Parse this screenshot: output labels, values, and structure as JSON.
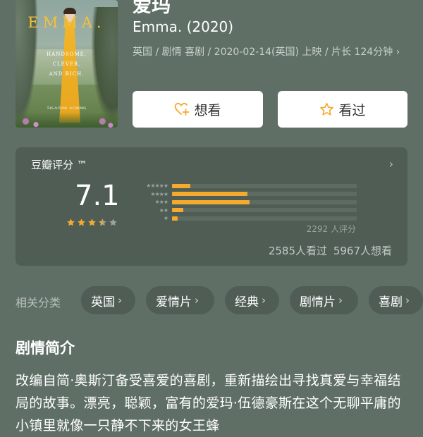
{
  "poster": {
    "title": "EMMA.",
    "tagline_lines": [
      "HANDSOME,",
      "CLEVER,",
      "AND RICH."
    ],
    "small_text": "THIS AUTUMN · IN CINEMAS"
  },
  "movie": {
    "title": "爱玛",
    "original_title": "Emma. (2020)",
    "meta": "英国 / 剧情 喜剧 / 2020-02-14(英国) 上映 / 片长 124分钟",
    "meta_chevron": "›"
  },
  "actions": {
    "want_label": "想看",
    "want_icon": "heart-plus-icon",
    "seen_label": "看过",
    "seen_icon": "star-outline-icon"
  },
  "rating": {
    "label": "豆瓣评分 ™",
    "score": "7.1",
    "stars_value": 3.5,
    "stars_max": 5,
    "distribution": [
      {
        "stars": "★★★★★",
        "percent": 10
      },
      {
        "stars": "★★★★",
        "percent": 41
      },
      {
        "stars": "★★★",
        "percent": 42
      },
      {
        "stars": "★★",
        "percent": 6
      },
      {
        "stars": "★",
        "percent": 3
      }
    ],
    "count_text": "2292 人评分",
    "watched_text": "2585人看过",
    "want_text": "5967人想看",
    "accent_color": "#f5aa2e"
  },
  "categories": {
    "label": "相关分类",
    "items": [
      "英国",
      "爱情片",
      "经典",
      "剧情片",
      "喜剧"
    ]
  },
  "synopsis": {
    "heading": "剧情简介",
    "text": "改编自简·奥斯汀备受喜爱的喜剧，重新描绘出寻找真爱与幸福结局的故事。漂亮，聪颖，富有的爱玛·伍德豪斯在这个无聊平庸的小镇里就像一只静不下来的女王蜂"
  }
}
